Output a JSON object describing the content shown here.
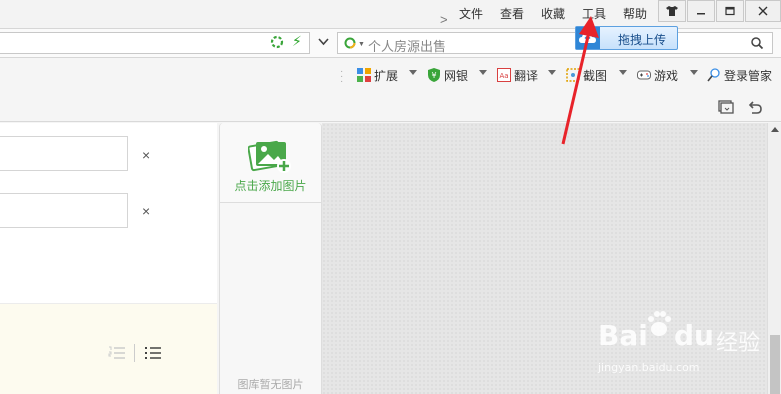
{
  "menu": {
    "items": [
      "文件",
      "查看",
      "收藏",
      "工具",
      "帮助"
    ],
    "chevron": ">"
  },
  "window_controls": [
    "skin-icon",
    "minimize-icon",
    "maximize-icon"
  ],
  "address_bar": {
    "search_placeholder": "个人房源出售",
    "upload_tip": "拖拽上传"
  },
  "toolbar": {
    "items": [
      {
        "label": "扩展",
        "icon": "extensions-icon"
      },
      {
        "label": "网银",
        "icon": "bank-shield-icon"
      },
      {
        "label": "翻译",
        "icon": "translate-icon"
      },
      {
        "label": "截图",
        "icon": "screenshot-icon"
      },
      {
        "label": "游戏",
        "icon": "game-icon"
      },
      {
        "label": "登录管家",
        "icon": "login-manager-icon"
      }
    ]
  },
  "form": {
    "fields": [
      {
        "value": ""
      },
      {
        "value": ""
      }
    ],
    "clear_symbol": "×"
  },
  "gallery": {
    "add_label": "点击添加图片",
    "empty_label": "图库暂无图片"
  },
  "watermark": {
    "brand": "Bai",
    "brand2": "du",
    "cn": "经验",
    "url": "jingyan.baidu.com"
  },
  "colors": {
    "accent_green": "#4aa84a",
    "annotation_red": "#e8232a",
    "upload_blue": "#2f86d6"
  }
}
